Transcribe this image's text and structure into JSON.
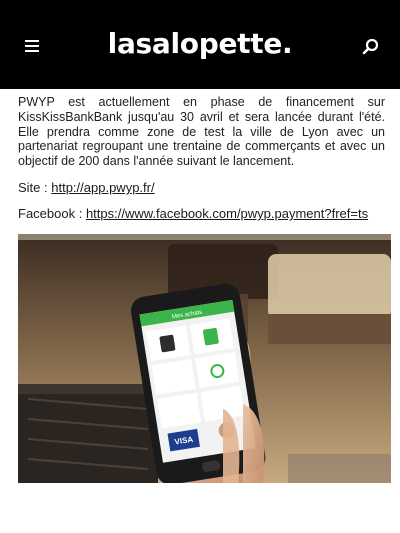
{
  "header": {
    "logo": "lasalopette."
  },
  "article": {
    "paragraph": "PWYP est actuellement en phase de financement sur KissKissBankBank jusqu'au 30 avril et sera lancée durant l'été. Elle prendra comme zone de test la ville de Lyon avec un partenariat regroupant une trentaine de commerçants et avec un objectif de 200 dans l'année suivant le lancement.",
    "site_label": "Site : ",
    "site_link": "http://app.pwyp.fr/",
    "facebook_label": "Facebook : ",
    "facebook_link": "https://www.facebook.com/pwyp.payment?fref=ts"
  },
  "photo": {
    "app_header": "Mes achats",
    "card_brand": "VISA"
  }
}
